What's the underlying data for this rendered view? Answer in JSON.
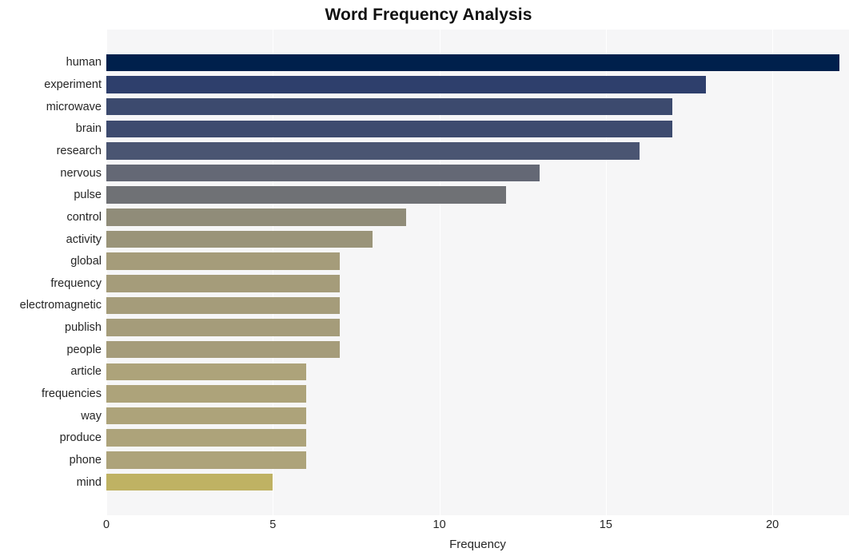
{
  "chart_data": {
    "type": "bar",
    "orientation": "horizontal",
    "title": "Word Frequency Analysis",
    "xlabel": "Frequency",
    "ylabel": "",
    "xlim": [
      0,
      22.3
    ],
    "ylim": [
      0,
      20
    ],
    "grid": true,
    "legend": null,
    "xticks": [
      "0",
      "5",
      "10",
      "15",
      "20"
    ],
    "xtick_values": [
      0,
      5,
      10,
      15,
      20
    ],
    "categories": [
      "human",
      "experiment",
      "microwave",
      "brain",
      "research",
      "nervous",
      "pulse",
      "control",
      "activity",
      "global",
      "frequency",
      "electromagnetic",
      "publish",
      "people",
      "article",
      "frequencies",
      "way",
      "produce",
      "phone",
      "mind"
    ],
    "values": [
      22,
      18,
      17,
      17,
      16,
      13,
      12,
      9,
      8,
      7,
      7,
      7,
      7,
      7,
      6,
      6,
      6,
      6,
      6,
      5
    ],
    "colors": [
      "#00204c",
      "#2e3f6c",
      "#3c4a6e",
      "#3d4b6f",
      "#4a5572",
      "#646875",
      "#6f7175",
      "#908c79",
      "#9a9479",
      "#a59c7a",
      "#a59c7a",
      "#a59c7a",
      "#a59c7a",
      "#a59c7a",
      "#ada37a",
      "#ada37a",
      "#ada37a",
      "#ada37a",
      "#ada37a",
      "#bfb263"
    ],
    "plot_background": "#f6f6f7",
    "grid_color": "#ffffff",
    "text_color": "#262626"
  }
}
